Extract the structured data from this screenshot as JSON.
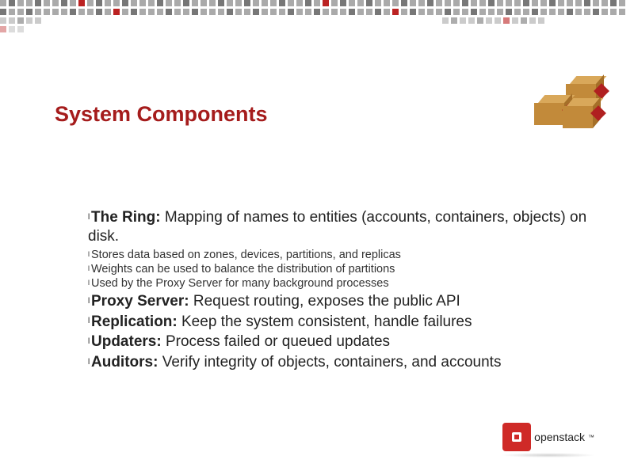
{
  "title": "System Components",
  "items": {
    "ring": {
      "lead": "The Ring:",
      "text": " Mapping of names to entities (accounts, containers, objects) on disk.",
      "subs": [
        "Stores data based on zones, devices, partitions, and replicas",
        "Weights can be used to balance the distribution of partitions",
        "Used by the Proxy Server for many background processes"
      ]
    },
    "proxy": {
      "lead": "Proxy Server:",
      "text": " Request routing, exposes the public API"
    },
    "replication": {
      "lead": "Replication:",
      "text": " Keep the system consistent, handle failures"
    },
    "updaters": {
      "lead": "Updaters:",
      "text": " Process failed or queued updates"
    },
    "auditors": {
      "lead": "Auditors:",
      "text": " Verify integrity of objects, containers, and accounts"
    }
  },
  "logo": {
    "text": "openstack",
    "tm": "™"
  },
  "colors": {
    "accent": "#a51c1c",
    "logo": "#cf2a27"
  }
}
